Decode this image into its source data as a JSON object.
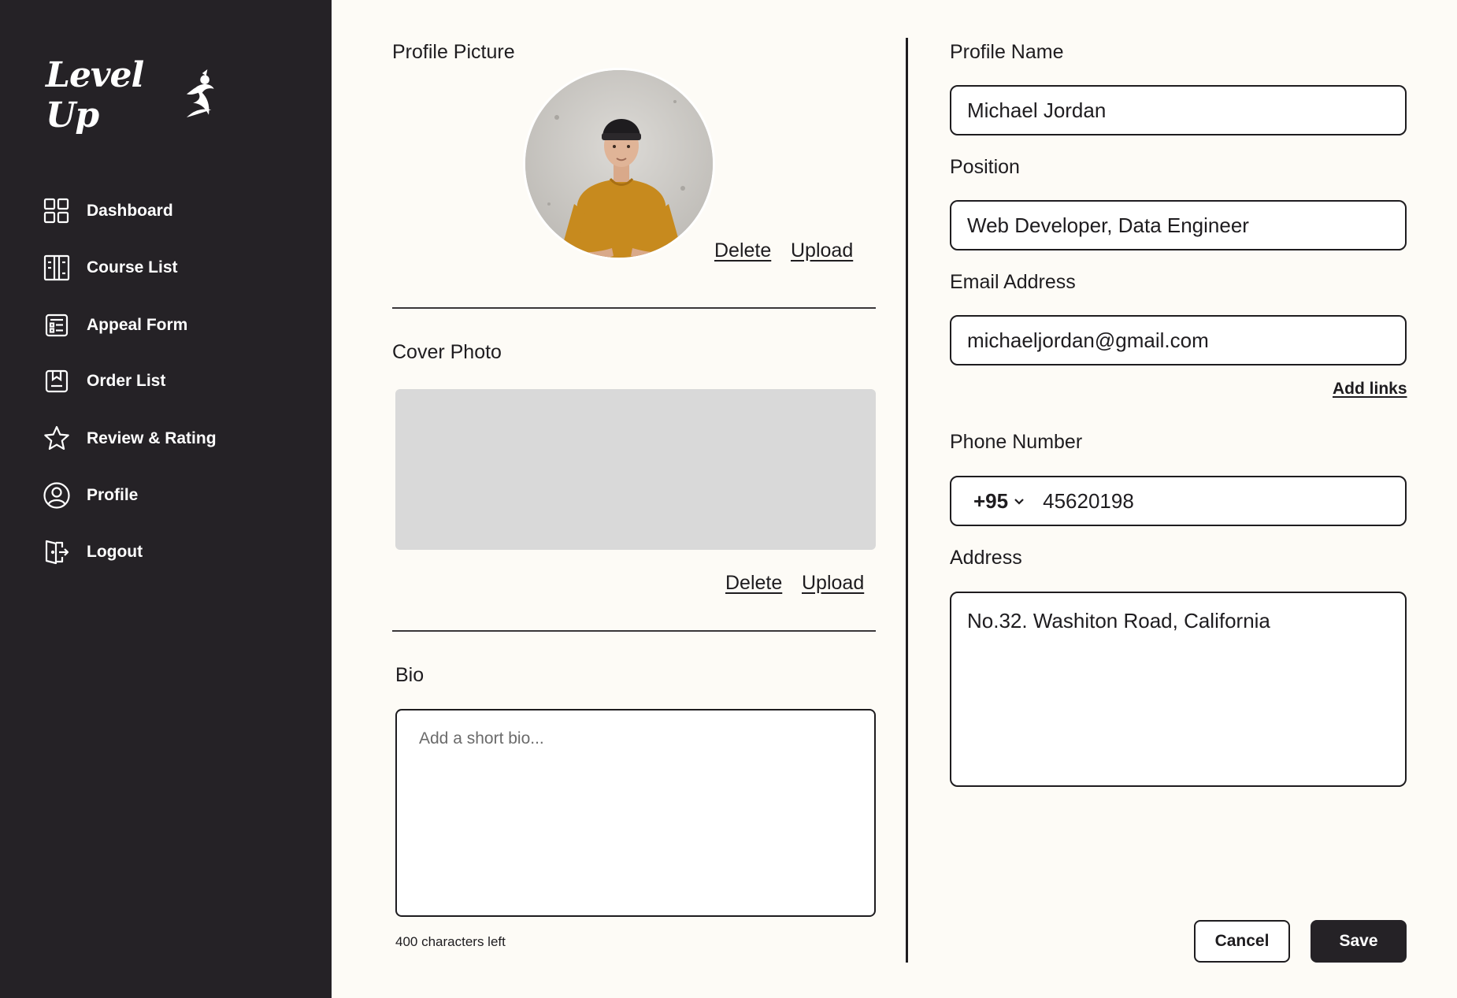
{
  "brand": {
    "logo_text": "Level Up",
    "accent_color": "#f0a640",
    "sidebar_color": "#252226"
  },
  "sidebar": {
    "items": [
      {
        "label": "Dashboard",
        "icon": "dashboard-icon"
      },
      {
        "label": "Course List",
        "icon": "course-list-icon"
      },
      {
        "label": "Appeal Form",
        "icon": "appeal-form-icon"
      },
      {
        "label": "Order List",
        "icon": "order-list-icon"
      },
      {
        "label": "Review & Rating",
        "icon": "star-icon"
      },
      {
        "label": "Profile",
        "icon": "user-circle-icon"
      },
      {
        "label": "Logout",
        "icon": "logout-icon"
      }
    ]
  },
  "profile_picture": {
    "title": "Profile Picture",
    "delete_label": "Delete",
    "upload_label": "Upload"
  },
  "cover_photo": {
    "title": "Cover Photo",
    "delete_label": "Delete",
    "upload_label": "Upload"
  },
  "bio": {
    "title": "Bio",
    "placeholder": "Add a short bio...",
    "chars_left": "400 characters left"
  },
  "form": {
    "name_label": "Profile Name",
    "name_value": "Michael Jordan",
    "position_label": "Position",
    "position_value": "Web Developer, Data Engineer",
    "email_label": "Email Address",
    "email_value": "michaeljordan@gmail.com",
    "add_links": "Add links",
    "phone_label": "Phone Number",
    "phone_code": "+95",
    "phone_value": "45620198",
    "address_label": "Address",
    "address_value": "No.32. Washiton Road, California"
  },
  "actions": {
    "cancel_label": "Cancel",
    "save_label": "Save"
  }
}
